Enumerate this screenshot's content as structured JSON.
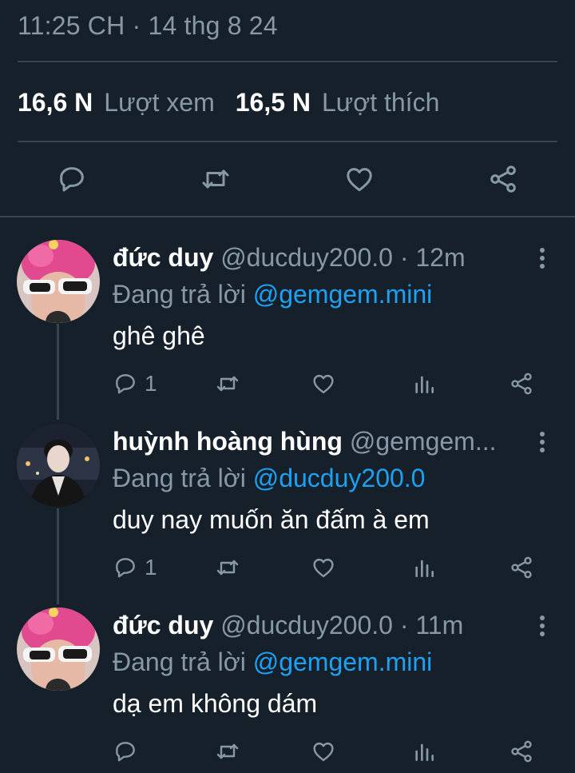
{
  "tweet": {
    "timestamp": "11:25 CH · 14 thg 8 24",
    "views_count": "16,6 N",
    "views_label": "Lượt xem",
    "likes_count": "16,5 N",
    "likes_label": "Lượt thích"
  },
  "replies": [
    {
      "name": "đức duy",
      "handle": "@ducduy200.0 · 12m",
      "replying_prefix": "Đang trả lời",
      "replying_to": "@gemgem.mini",
      "text": "ghê ghê",
      "reply_count": "1",
      "avatar": "pink-hair-sunglasses"
    },
    {
      "name": "huỳnh hoàng hùng",
      "handle": "@gemgem...",
      "replying_prefix": "Đang trả lời",
      "replying_to": "@ducduy200.0",
      "text": "duy nay muốn ăn đấm à em",
      "reply_count": "1",
      "avatar": "dark-jacket-street"
    },
    {
      "name": "đức duy",
      "handle": "@ducduy200.0 · 11m",
      "replying_prefix": "Đang trả lời",
      "replying_to": "@gemgem.mini",
      "text": "dạ em không dám",
      "reply_count": "",
      "avatar": "pink-hair-sunglasses"
    }
  ],
  "colors": {
    "background": "#15202b",
    "muted_text": "#8899a6",
    "link": "#1da1f2",
    "divider": "#38444d"
  }
}
